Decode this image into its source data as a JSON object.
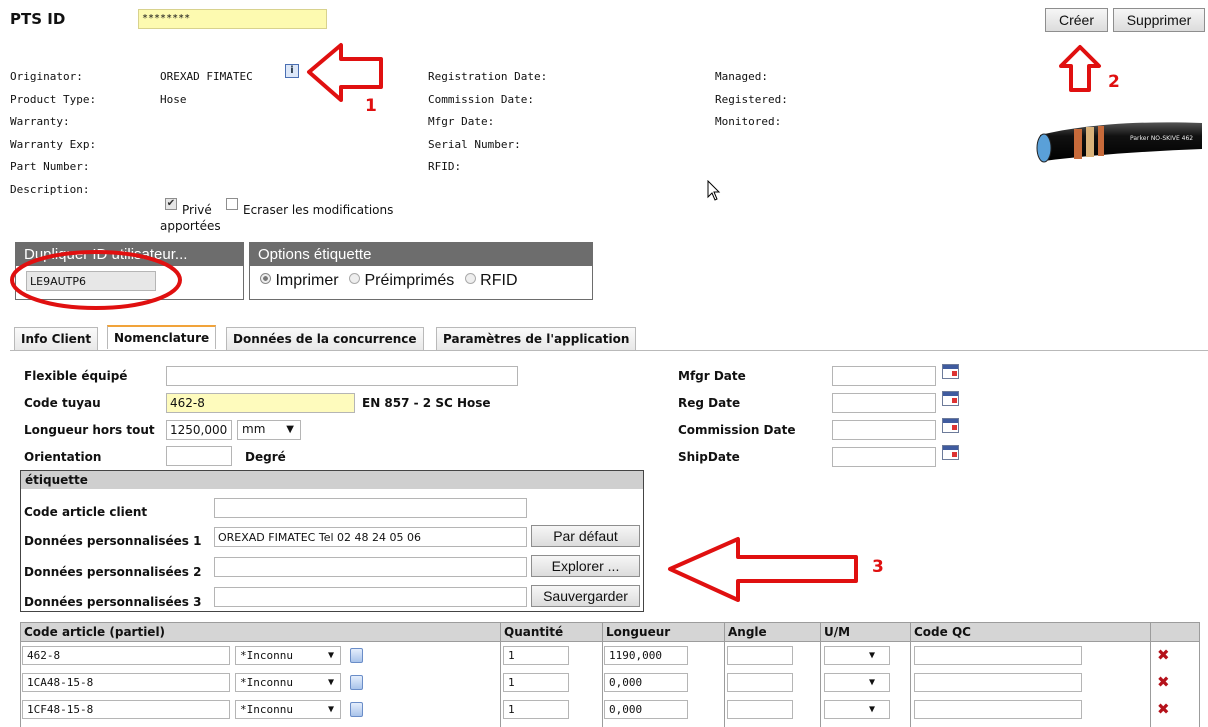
{
  "header": {
    "pts_label": "PTS ID",
    "pts_value": "********",
    "create_label": "Créer",
    "delete_label": "Supprimer"
  },
  "info": {
    "col1": [
      {
        "label": "Originator:",
        "value": "OREXAD FIMATEC"
      },
      {
        "label": "Product Type:",
        "value": "Hose"
      },
      {
        "label": "Warranty:",
        "value": ""
      },
      {
        "label": "Warranty Exp:",
        "value": ""
      },
      {
        "label": "Part Number:",
        "value": ""
      },
      {
        "label": "Description:",
        "value": ""
      }
    ],
    "col2": [
      "Registration Date:",
      "Commission Date:",
      "Mfgr Date:",
      "Serial Number:",
      "RFID:"
    ],
    "col3": [
      "Managed:",
      "Registered:",
      "Monitored:"
    ],
    "hose_brand": "Parker NO-SKIVE 462",
    "private_label": "Privé",
    "overwrite_label_1": "Ecraser les modifications",
    "overwrite_label_2": "apportées"
  },
  "duplicate": {
    "title": "Dupliquer ID utilisateur...",
    "value": "LE9AUTP6"
  },
  "label_options": {
    "title": "Options étiquette",
    "print": "Imprimer",
    "preprinted": "Préimprimés",
    "rfid": "RFID"
  },
  "annotations": {
    "n1": "1",
    "n2": "2",
    "n3": "3"
  },
  "tabs": [
    "Info Client",
    "Nomenclature",
    "Données de la concurrence",
    "Paramètres de l'application"
  ],
  "form": {
    "equipped_label": "Flexible équipé",
    "hose_code_label": "Code tuyau",
    "hose_code_value": "462-8",
    "hose_desc": "EN 857 - 2 SC Hose",
    "length_label": "Longueur hors tout",
    "length_value": "1250,000",
    "length_unit": "mm",
    "orientation_label": "Orientation",
    "degree_label": "Degré",
    "mfgr_date": "Mfgr Date",
    "reg_date": "Reg Date",
    "commission_date": "Commission Date",
    "ship_date": "ShipDate"
  },
  "etiquette": {
    "title": "étiquette",
    "client_code": "Code article client",
    "custom1": "Données personnalisées 1",
    "custom1_value": "OREXAD FIMATEC Tel 02 48 24 05 06",
    "custom2": "Données personnalisées 2",
    "custom3": "Données personnalisées 3",
    "default_btn": "Par défaut",
    "explore_btn": "Explorer ...",
    "save_btn": "Sauvergarder"
  },
  "grid": {
    "headers": [
      "Code article (partiel)",
      "Quantité",
      "Longueur",
      "Angle",
      "U/M",
      "Code QC"
    ],
    "rows": [
      {
        "code": "462-8",
        "type": "*Inconnu",
        "qty": "1",
        "length": "1190,000"
      },
      {
        "code": "1CA48-15-8",
        "type": "*Inconnu",
        "qty": "1",
        "length": "0,000"
      },
      {
        "code": "1CF48-15-8",
        "type": "*Inconnu",
        "qty": "1",
        "length": "0,000"
      }
    ]
  }
}
